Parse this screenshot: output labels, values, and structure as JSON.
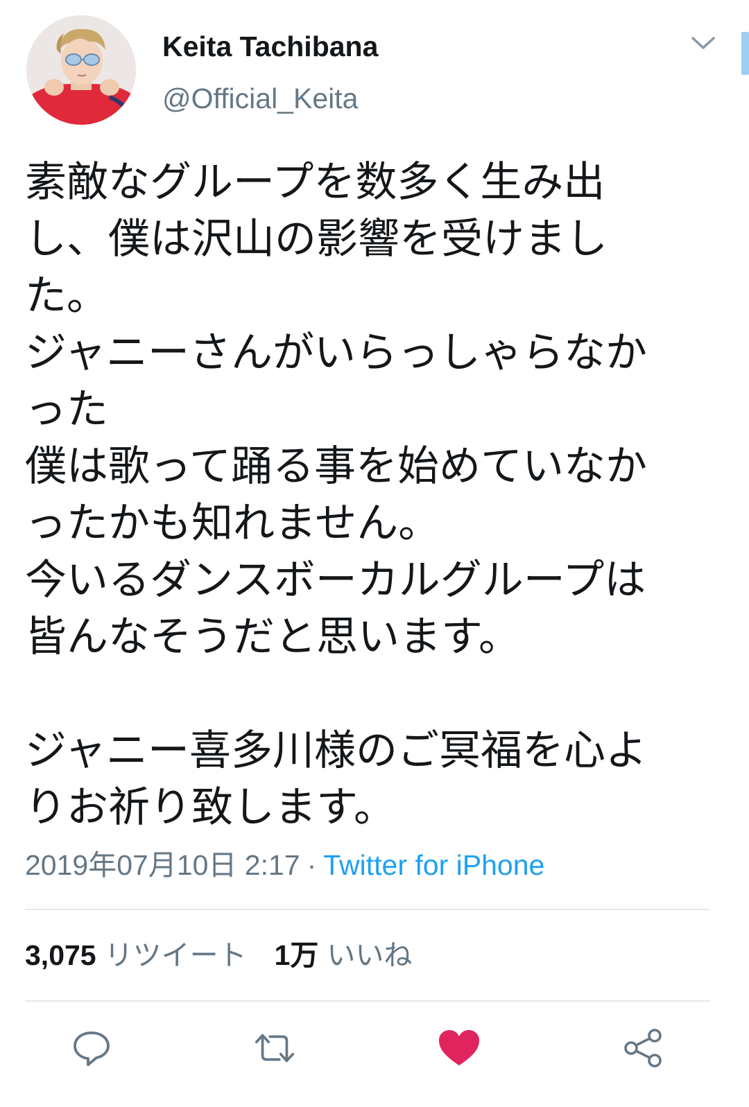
{
  "user": {
    "display_name": "Keita Tachibana",
    "handle": "@Official_Keita",
    "avatar_icon": "profile-photo"
  },
  "tweet": {
    "lines": [
      "素敵なグループを数多く生み出",
      "し、僕は沢山の影響を受けまし",
      "た。",
      "ジャニーさんがいらっしゃらなか",
      "った",
      "僕は歌って踊る事を始めていなか",
      "ったかも知れません。",
      "今いるダンスボーカルグループは",
      "皆んなそうだと思います。",
      "",
      "ジャニー喜多川様のご冥福を心よ",
      "りお祈り致します。"
    ]
  },
  "meta": {
    "timestamp": "2019年07月10日 2:17",
    "separator": "·",
    "source": "Twitter for iPhone"
  },
  "stats": {
    "retweet_count": "3,075",
    "retweet_label": "リツイート",
    "like_count": "1万",
    "like_label": "いいね"
  },
  "actions": {
    "reply_icon": "reply-icon",
    "retweet_icon": "retweet-icon",
    "like_icon": "heart-icon",
    "share_icon": "share-icon",
    "liked": true
  },
  "colors": {
    "text": "#14171a",
    "secondary": "#657786",
    "link": "#1da1f2",
    "like": "#e0245e",
    "divider": "#e1e8ed"
  }
}
